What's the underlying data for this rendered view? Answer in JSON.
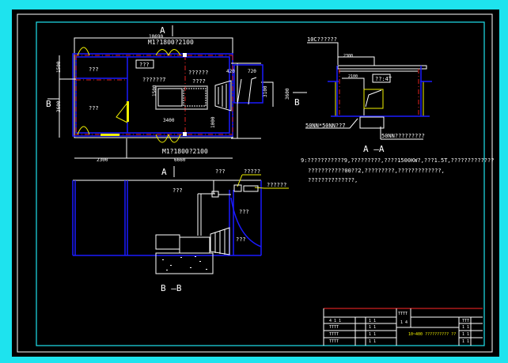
{
  "colors": {
    "background": "#000000",
    "frame": "#1ee3ee",
    "wall": "#1a1aff",
    "axis": "#e02020",
    "door": "#f2f200",
    "line": "#ffffff"
  },
  "plan": {
    "section_a": "A",
    "section_b": "B",
    "dim_top": "10690",
    "door_top": "M1?1800?2100",
    "door_bottom": "M1?1800?2100",
    "room_small": "???",
    "room_large": "???",
    "label_box": "???",
    "label_machine": "??????",
    "label_base": "??????7",
    "label_engine": "????",
    "dim_left1": "1500",
    "dim_left2": "3600",
    "dim_bottom1": "2300",
    "dim_bottom2": "6660",
    "dim_engine": "3400",
    "dim_engine_v": "1000",
    "dim_small": "1500",
    "dim_right1": "420",
    "dim_right2": "720",
    "dim_right3": "3100",
    "dim_right4": "3600"
  },
  "section_aa": {
    "title": "A —A",
    "top_label": "10C??????",
    "dim1": "2300",
    "dim2": "2100",
    "label_mid": "??:4T",
    "label_left": "50NN*50NN??7",
    "label_right": "50NN?????????"
  },
  "notes": [
    "9:???????????9,?????????,????1500KW?,???1.5T,?????????????",
    "???????????00??2,?????????,?????????????,",
    "??????????????,"
  ],
  "section_bb": {
    "title": "B —B",
    "section_a": "A",
    "label_top1": "???",
    "label_top2": "?????",
    "label_top3": "??????",
    "label_room": "???",
    "label_right": "???",
    "label_lower": "???"
  },
  "title_block": {
    "project": "TTTT",
    "title": "10~400 ?????????? ??",
    "rows_left": [
      "4 1 1",
      "TTTT",
      "TTTT",
      "TTTT"
    ],
    "rows_mid": [
      "1 1",
      "1 1",
      "1 1",
      "1 1"
    ],
    "mid": "1 4",
    "right": [
      "TTT",
      "1 1",
      "1 1",
      "1 1",
      "1 1"
    ]
  }
}
